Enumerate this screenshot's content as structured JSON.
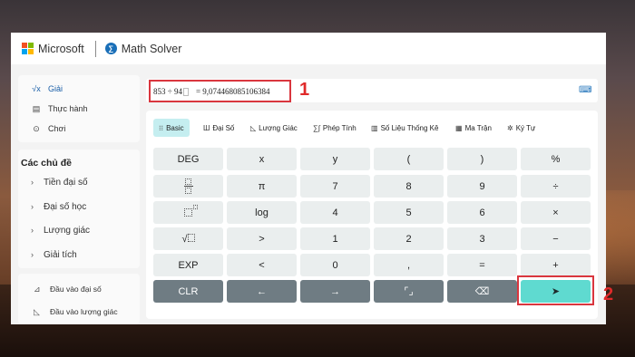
{
  "app": {
    "brand": "Microsoft",
    "product": "Math Solver",
    "brand_colors": [
      "#f25022",
      "#7fba00",
      "#00a4ef",
      "#ffb900"
    ],
    "accent": "#1a5fa8",
    "highlight_color": "#d9363e"
  },
  "nav": {
    "items": [
      {
        "label": "Giải",
        "icon": "sqrt-x-icon",
        "active": true
      },
      {
        "label": "Thực hành",
        "icon": "notebook-icon",
        "active": false
      },
      {
        "label": "Chơi",
        "icon": "gamepad-icon",
        "active": false
      }
    ]
  },
  "topics": {
    "title": "Các chủ đề",
    "items": [
      "Tiền đại số",
      "Đại số học",
      "Lượng giác",
      "Giải tích"
    ]
  },
  "inputs": {
    "items": [
      "Đầu vào đại số",
      "Đầu vào lượng giác"
    ]
  },
  "expression": {
    "lhs": "853 ÷ 94",
    "result": "= 9,074468085106384",
    "keyboard_icon": "keyboard-icon"
  },
  "tabs": [
    {
      "label": "Basic",
      "icon": "basic-icon",
      "active": true
    },
    {
      "label": "Đại Số",
      "icon": "algebra-icon",
      "active": false
    },
    {
      "label": "Lượng Giác",
      "icon": "trig-icon",
      "active": false
    },
    {
      "label": "Phép Tính",
      "icon": "calculus-icon",
      "active": false
    },
    {
      "label": "Số Liệu Thống Kê",
      "icon": "stats-icon",
      "active": false
    },
    {
      "label": "Ma Trận",
      "icon": "matrix-icon",
      "active": false
    },
    {
      "label": "Ký Tự",
      "icon": "symbols-icon",
      "active": false
    }
  ],
  "keypad": {
    "deg": "DEG",
    "x": "x",
    "y": "y",
    "lparen": "(",
    "rparen": ")",
    "percent": "%",
    "pi": "π",
    "seven": "7",
    "eight": "8",
    "nine": "9",
    "divide": "÷",
    "log": "log",
    "four": "4",
    "five": "5",
    "six": "6",
    "multiply": "×",
    "greater": ">",
    "one": "1",
    "two": "2",
    "three": "3",
    "minus": "−",
    "exp": "EXP",
    "less": "<",
    "zero": "0",
    "comma": ",",
    "equals": "=",
    "plus": "+",
    "clr": "CLR",
    "left_arrow": "←",
    "right_arrow": "→",
    "backspace": "⌫",
    "submit": "➤"
  },
  "annotations": {
    "marker_1": "1",
    "marker_2": "2"
  }
}
